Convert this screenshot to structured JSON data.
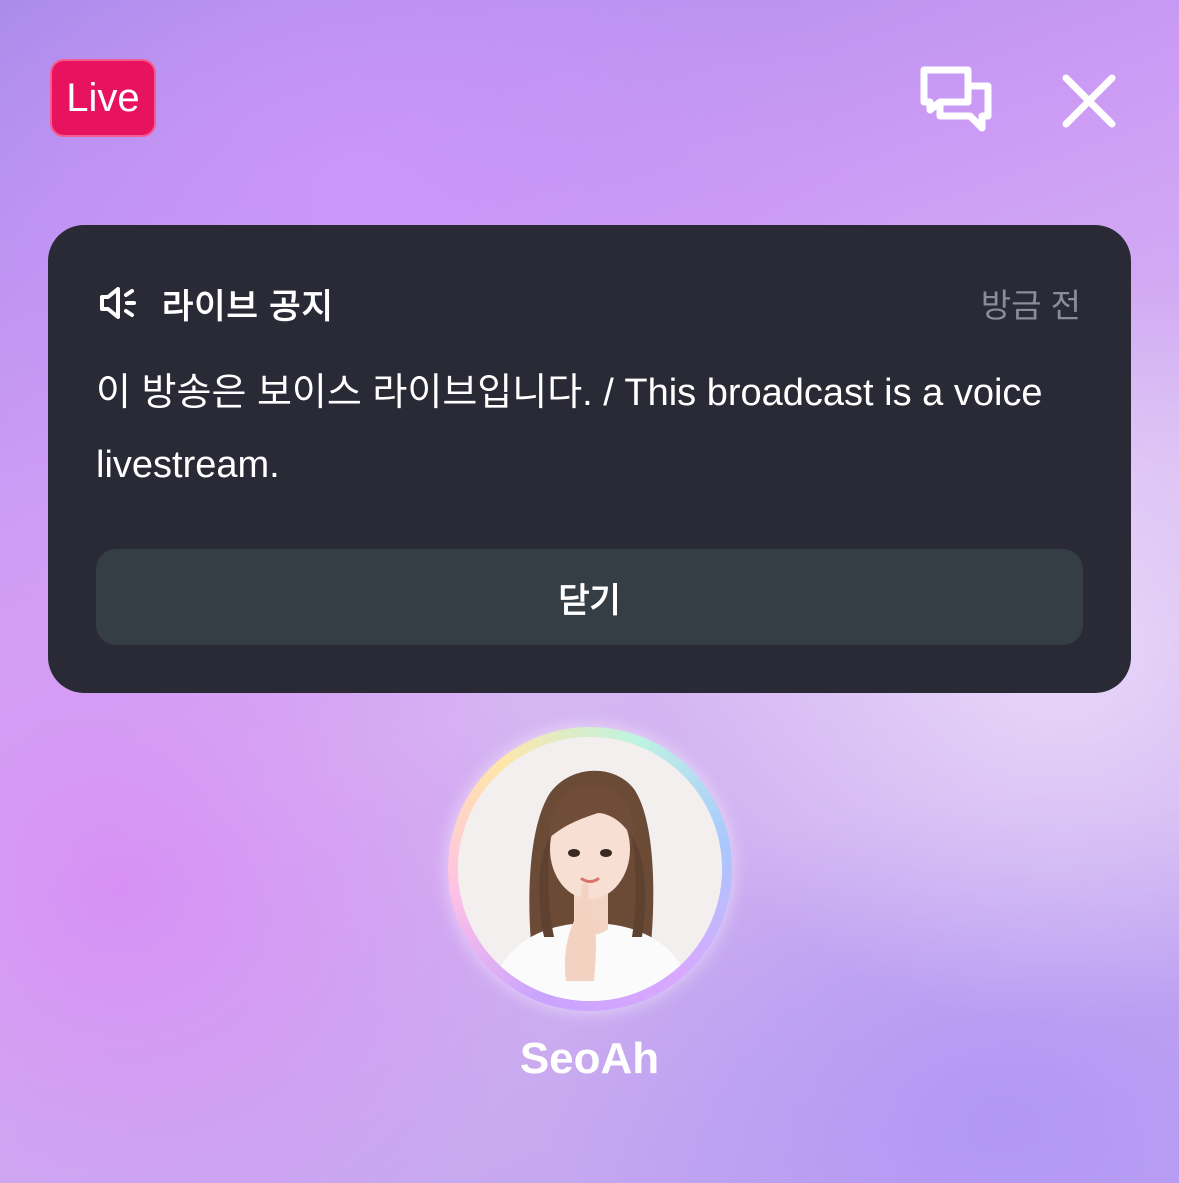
{
  "header": {
    "live_label": "Live",
    "chat_icon": "chat-bubbles-icon",
    "close_icon": "close-icon"
  },
  "notice": {
    "icon": "megaphone-icon",
    "title": "라이브 공지",
    "time": "방금 전",
    "body": "이 방송은 보이스 라이브입니다. / This broadcast is a voice livestream.",
    "close_label": "닫기"
  },
  "host": {
    "name": "SeoAh",
    "avatar": "host-avatar-photo"
  },
  "colors": {
    "live_badge": "#e8135e",
    "notice_bg": "#292a36",
    "button_bg": "#353d45"
  }
}
